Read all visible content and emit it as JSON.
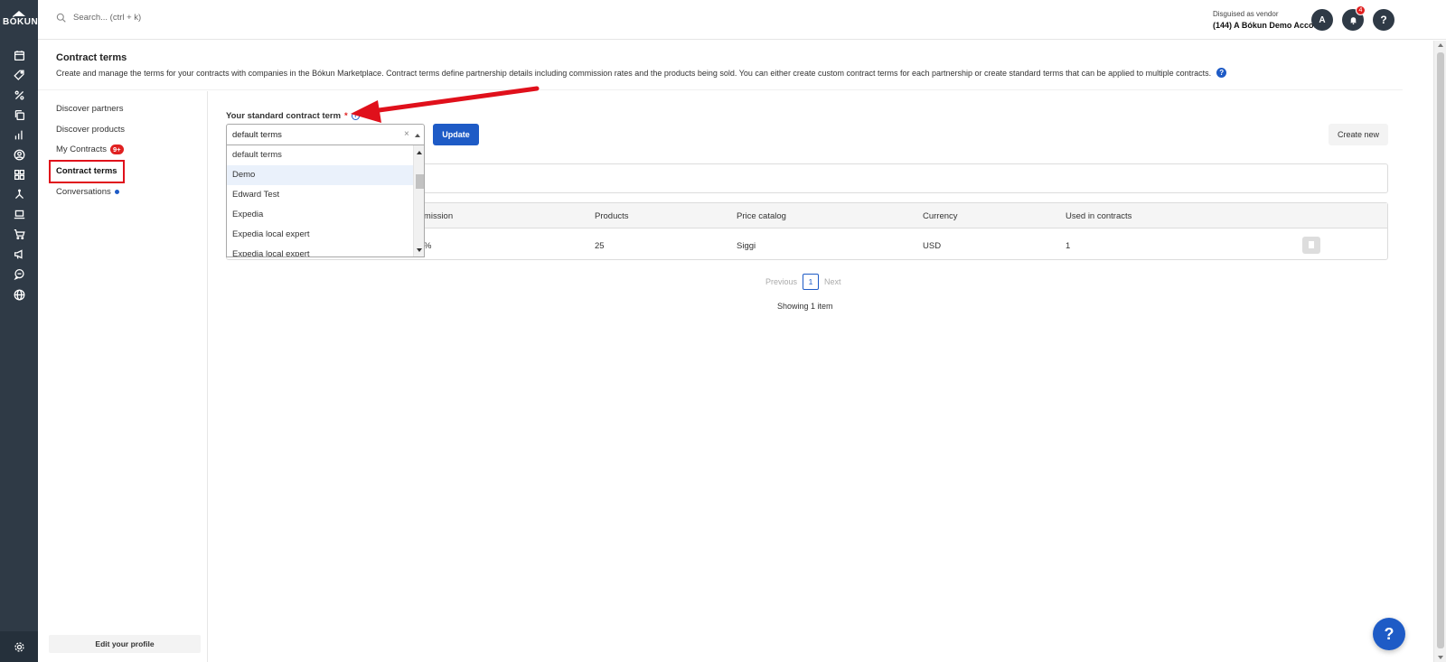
{
  "brand": {
    "logo_text": "BÓKUN"
  },
  "search": {
    "placeholder": "Search... (ctrl + k)"
  },
  "vendor": {
    "line1": "Disguised as vendor",
    "line2": "(144) A Bókun Demo Account."
  },
  "topbar": {
    "avatar_letter": "A",
    "notifications_count": "4",
    "help_label": "?"
  },
  "header": {
    "title": "Contract terms",
    "description": "Create and manage the terms for your contracts with companies in the Bókun Marketplace. Contract terms define partnership details including commission rates and the products being sold. You can either create custom contract terms for each partnership or create standard terms that can be applied to multiple contracts."
  },
  "subnav": {
    "items": [
      {
        "label": "Discover partners"
      },
      {
        "label": "Discover products"
      },
      {
        "label": "My Contracts",
        "badge": "9+"
      },
      {
        "label": "Contract terms"
      },
      {
        "label": "Conversations"
      }
    ],
    "edit_profile": "Edit your profile"
  },
  "form": {
    "label": "Your standard contract term",
    "required_mark": "*",
    "selected_value": "default terms",
    "update_button": "Update",
    "create_button": "Create new",
    "options": [
      "default terms",
      "Demo",
      "Edward Test",
      "Expedia",
      "Expedia local expert",
      "Expedia local expert"
    ]
  },
  "table": {
    "headers": [
      "mmission",
      "Products",
      "Price catalog",
      "Currency",
      "Used in contracts"
    ],
    "row": {
      "commission": "%",
      "products": "25",
      "price_catalog": "Siggi",
      "currency": "USD",
      "used_in_contracts": "1"
    }
  },
  "pagination": {
    "previous": "Previous",
    "page": "1",
    "next": "Next",
    "showing": "Showing 1 item"
  },
  "colors": {
    "rail": "#2f3a46",
    "accent": "#1e5bc6",
    "highlight": "#e0101b",
    "badge": "#e02020"
  },
  "icons": [
    "calendar-icon",
    "tag-icon",
    "percent-icon",
    "copy-icon",
    "bar-chart-icon",
    "user-circle-icon",
    "grid-icon",
    "sitemap-icon",
    "laptop-icon",
    "cart-icon",
    "megaphone-icon",
    "chat-icon",
    "globe-icon",
    "gear-icon"
  ]
}
